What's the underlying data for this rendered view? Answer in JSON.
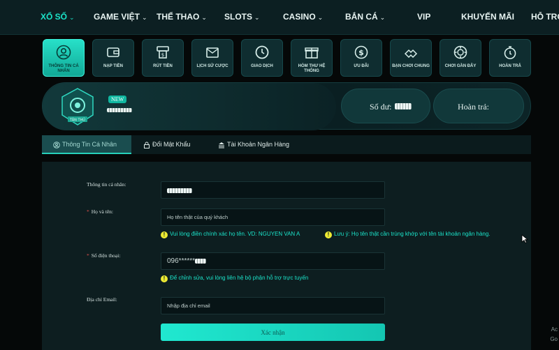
{
  "topnav": {
    "items": [
      {
        "label": "XỔ SỐ",
        "caret": true
      },
      {
        "label": "GAME VIỆT",
        "caret": true
      },
      {
        "label": "THỂ THAO",
        "caret": true
      },
      {
        "label": "SLOTS",
        "caret": true
      },
      {
        "label": "CASINO",
        "caret": true
      },
      {
        "label": "BẮN CÁ",
        "caret": true
      },
      {
        "label": "VIP",
        "caret": false
      },
      {
        "label": "KHUYẾN MÃI",
        "caret": false
      },
      {
        "label": "HỖ TRỢ",
        "caret": false
      }
    ]
  },
  "quickmenu": {
    "items": [
      {
        "label": "THÔNG TIN CÁ NHÂN",
        "icon": "user-icon"
      },
      {
        "label": "NẠP TIỀN",
        "icon": "wallet-icon"
      },
      {
        "label": "RÚT TIỀN",
        "icon": "atm-icon"
      },
      {
        "label": "LỊCH SỬ CƯỢC",
        "icon": "history-icon"
      },
      {
        "label": "GIAO DỊCH",
        "icon": "clock-icon"
      },
      {
        "label": "HÒM THƯ HỆ THỐNG",
        "icon": "gift-box-icon"
      },
      {
        "label": "ƯU ĐÃI",
        "icon": "dollar-coin-icon"
      },
      {
        "label": "BẠN CHƠI CHUNG",
        "icon": "handshake-icon"
      },
      {
        "label": "CHƠI GẦN ĐÂY",
        "icon": "chip-icon"
      },
      {
        "label": "HOÀN TRẢ",
        "icon": "stopwatch-icon"
      }
    ]
  },
  "profile": {
    "rank": "TÂN THỦ",
    "new_tag": "NEW",
    "balance_label": "Số dư:",
    "rebate_label": "Hoàn trả:"
  },
  "tabs": [
    {
      "label": "Thông Tin Cá Nhân"
    },
    {
      "label": "Đổi Mật Khẩu"
    },
    {
      "label": "Tài Khoản Ngân Hàng"
    }
  ],
  "form": {
    "personal_info_label": "Thông tin cá nhân:",
    "fullname_label": "Họ và tên:",
    "fullname_placeholder": "Họ tên thật của quý khách",
    "fullname_note": "Vui lòng điền chính xác họ tên. VD: NGUYEN VAN A",
    "fullname_note2": "Lưu ý: Họ tên thật cần trùng khớp với tên tài khoản ngân hàng.",
    "phone_label": "Số điện thoại:",
    "phone_value": "096******",
    "phone_note": "Để chỉnh sửa, vui lòng liên hệ bộ phận hỗ trợ trực tuyến",
    "email_label": "Địa chỉ Email:",
    "email_placeholder": "Nhập địa chỉ email",
    "submit_label": "Xác nhận"
  },
  "side_mark": [
    "Ac",
    "Go"
  ],
  "colors": {
    "accent": "#1be3c9",
    "background": "#050808",
    "panel": "#0d1e20",
    "warning": "#eeeb33"
  }
}
